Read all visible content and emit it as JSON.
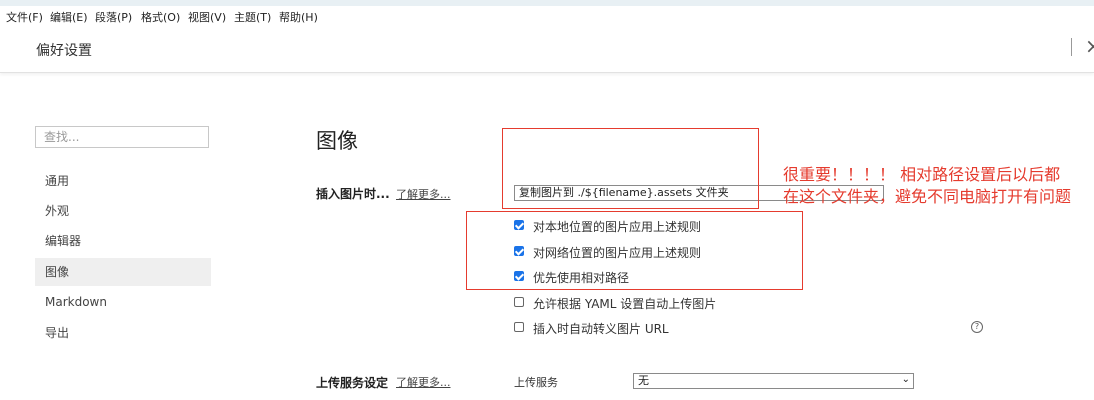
{
  "menubar": {
    "items": [
      "文件(F)",
      "编辑(E)",
      "段落(P)",
      "格式(O)",
      "视图(V)",
      "主题(T)",
      "帮助(H)"
    ]
  },
  "header": {
    "title": "偏好设置",
    "close_glyph": "×"
  },
  "sidebar": {
    "search_placeholder": "查找...",
    "items": [
      {
        "label": "通用"
      },
      {
        "label": "外观"
      },
      {
        "label": "编辑器"
      },
      {
        "label": "图像",
        "active": true
      },
      {
        "label": "Markdown"
      },
      {
        "label": "导出"
      }
    ]
  },
  "main": {
    "section_title": "图像",
    "insert_image": {
      "label": "插入图片时...",
      "learn_more": "了解更多...",
      "selected": "复制图片到 ./${filename}.assets 文件夹"
    },
    "checkboxes": [
      {
        "label": "对本地位置的图片应用上述规则",
        "checked": true
      },
      {
        "label": "对网络位置的图片应用上述规则",
        "checked": true
      },
      {
        "label": "优先使用相对路径",
        "checked": true
      },
      {
        "label": "允许根据 YAML 设置自动上传图片",
        "checked": false
      },
      {
        "label": "插入时自动转义图片 URL",
        "checked": false
      }
    ],
    "help_glyph": "?",
    "upload": {
      "label": "上传服务设定",
      "learn_more": "了解更多...",
      "service_label": "上传服务",
      "service_value": "无"
    }
  },
  "annotation": {
    "text": "很重要！！！！ 相对路径设置后以后都在这个文件夹，避免不同电脑打开有问题"
  },
  "colors": {
    "annotation_red": "#e53b2e",
    "checkbox_blue": "#1a73e8",
    "sidebar_active_bg": "#efefef"
  }
}
